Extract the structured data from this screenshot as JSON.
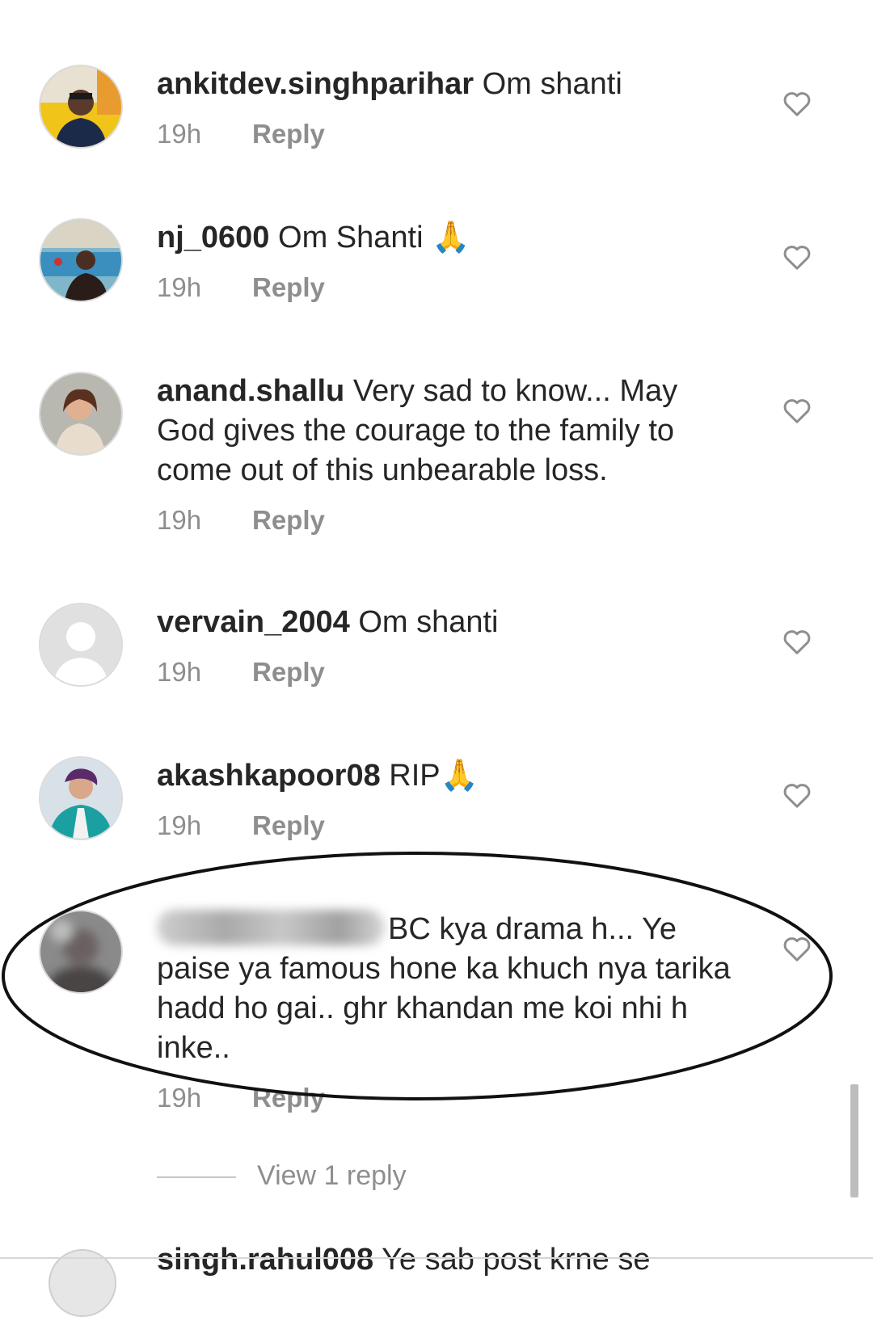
{
  "comments": [
    {
      "username": "ankitdev.singhparihar",
      "text": "Om shanti",
      "time": "19h",
      "reply_label": "Reply",
      "emoji": ""
    },
    {
      "username": "nj_0600",
      "text": "Om Shanti",
      "time": "19h",
      "reply_label": "Reply",
      "emoji": "🙏"
    },
    {
      "username": "anand.shallu",
      "text": "Very sad to know... May God gives the courage to the family to come out of this unbearable loss.",
      "time": "19h",
      "reply_label": "Reply",
      "emoji": ""
    },
    {
      "username": "vervain_2004",
      "text": "Om shanti",
      "time": "19h",
      "reply_label": "Reply",
      "emoji": ""
    },
    {
      "username": "akashkapoor08",
      "text": "RIP",
      "time": "19h",
      "reply_label": "Reply",
      "emoji": "🙏"
    },
    {
      "username": "",
      "text": "BC kya drama h... Ye paise ya famous hone ka khuch nya tarika hadd ho gai.. ghr khandan me koi nhi h inke..",
      "time": "19h",
      "reply_label": "Reply",
      "emoji": ""
    }
  ],
  "view_replies_label": "View 1 reply",
  "partial_comment": {
    "username": "singh.rahul008",
    "text": "Ye sab post krne se"
  },
  "colors": {
    "text": "#262626",
    "muted": "#8e8e8e",
    "background": "#ffffff"
  }
}
